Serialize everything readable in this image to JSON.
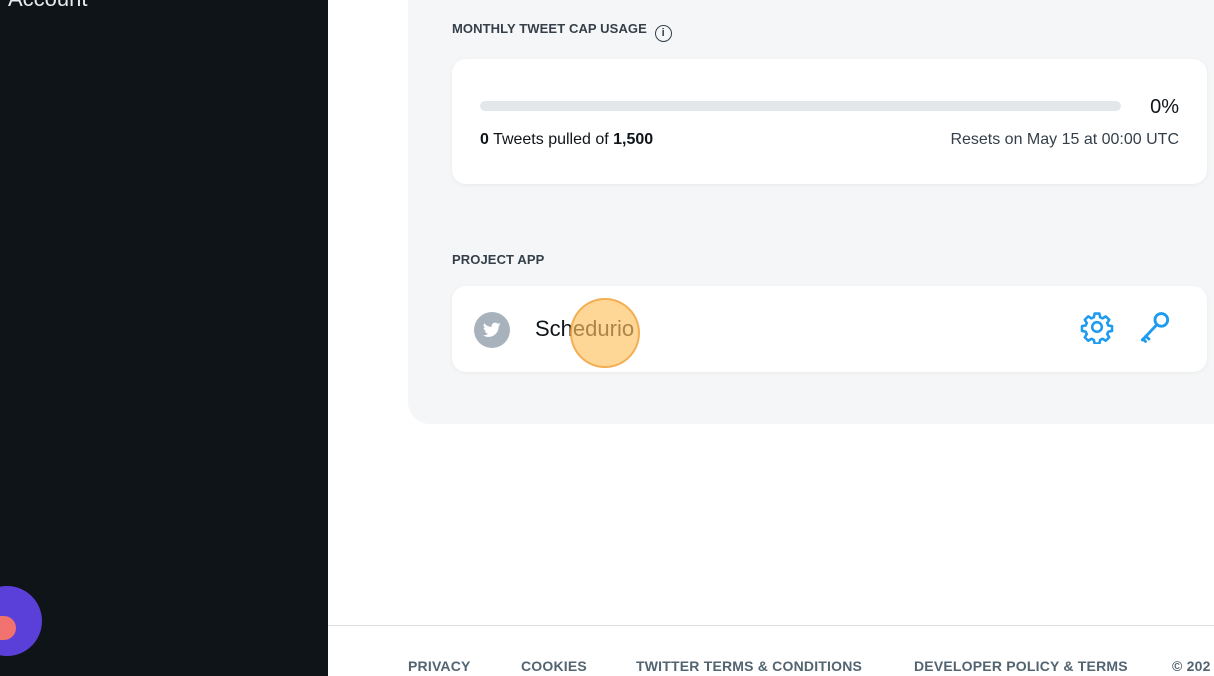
{
  "sidebar": {
    "partial_label": "Account"
  },
  "tweet_cap": {
    "section_title": "MONTHLY TWEET CAP USAGE",
    "info_icon": "info-icon",
    "percent_label": "0%",
    "progress_fraction": 0.0,
    "pulled": "0",
    "pulled_text": " Tweets pulled of ",
    "cap": "1,500",
    "reset_text": "Resets on May 15 at 00:00 UTC"
  },
  "project_app": {
    "section_title": "PROJECT APP",
    "app_name": "Schedurio",
    "avatar_icon": "twitter-bird-icon",
    "settings_icon": "gear-icon",
    "keys_icon": "key-icon"
  },
  "footer": {
    "links": [
      "PRIVACY",
      "COOKIES",
      "TWITTER TERMS & CONDITIONS",
      "DEVELOPER POLICY & TERMS",
      "© 202"
    ]
  },
  "colors": {
    "sidebar_bg": "#0f1419",
    "panel_bg": "#f5f6f7",
    "accent": "#1d9bf0",
    "fab": "#5b3fd9"
  }
}
